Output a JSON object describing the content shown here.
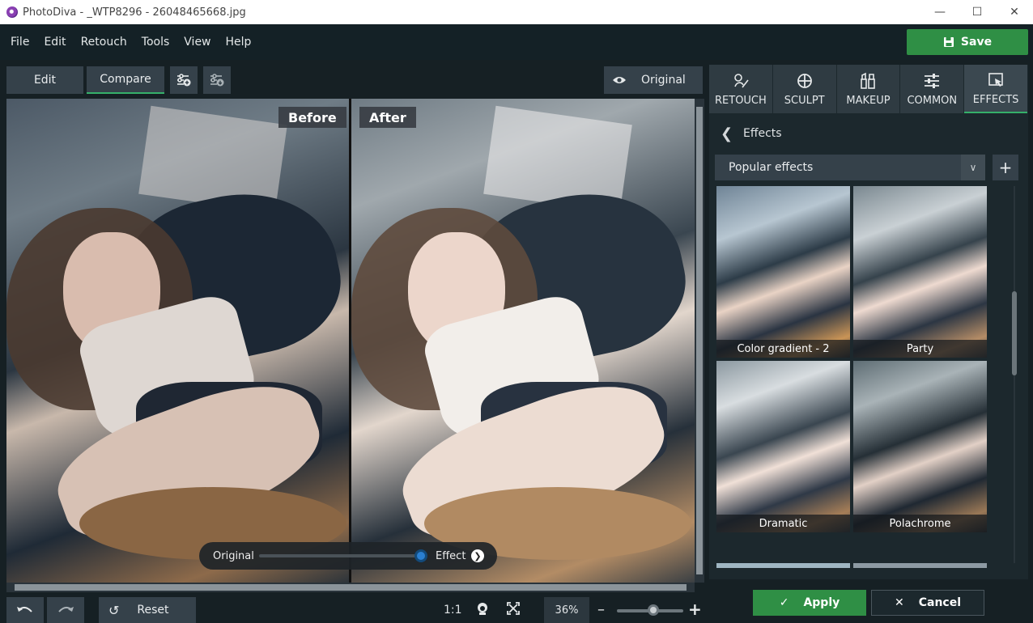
{
  "window": {
    "title": "PhotoDiva - _WTP8296 - 26048465668.jpg",
    "controls": [
      "minimize",
      "maximize",
      "close"
    ]
  },
  "menu": {
    "items": [
      "File",
      "Edit",
      "Retouch",
      "Tools",
      "View",
      "Help"
    ],
    "save_label": "Save"
  },
  "toolbar": {
    "edit_label": "Edit",
    "compare_label": "Compare",
    "compare_active": true,
    "original_label": "Original"
  },
  "canvas": {
    "before_label": "Before",
    "after_label": "After"
  },
  "effect_slider": {
    "left_label": "Original",
    "right_label": "Effect",
    "value": 1.0
  },
  "bottombar": {
    "reset_label": "Reset",
    "one_to_one": "1:1",
    "zoom": "36%",
    "zoom_minus": "–",
    "zoom_plus": "+"
  },
  "panel": {
    "tabs": [
      {
        "label": "RETOUCH",
        "icon": "retouch-icon"
      },
      {
        "label": "SCULPT",
        "icon": "sculpt-icon"
      },
      {
        "label": "MAKEUP",
        "icon": "makeup-icon"
      },
      {
        "label": "COMMON",
        "icon": "sliders-icon"
      },
      {
        "label": "EFFECTS",
        "icon": "effects-icon",
        "active": true
      }
    ],
    "breadcrumb": "Effects",
    "preset_category": "Popular effects",
    "presets": [
      {
        "label": "Color gradient - 2"
      },
      {
        "label": "Party"
      },
      {
        "label": "Dramatic"
      },
      {
        "label": "Polachrome",
        "selected": true
      }
    ]
  },
  "actions": {
    "apply_label": "Apply",
    "cancel_label": "Cancel"
  },
  "colors": {
    "accent_green": "#2f8f45",
    "background": "#162024",
    "panel": "#1c282d"
  }
}
